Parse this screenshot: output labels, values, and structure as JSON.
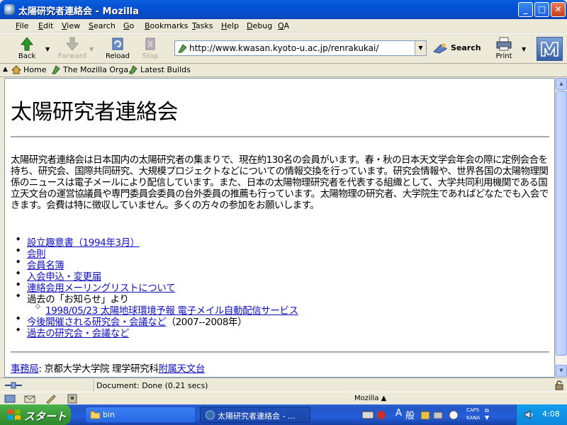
{
  "window": {
    "title": "太陽研究者連絡会 - Mozilla",
    "minimize": "_",
    "maximize": "□",
    "close": "✕"
  },
  "menu": [
    "File",
    "Edit",
    "View",
    "Search",
    "Go",
    "Bookmarks",
    "Tasks",
    "Help",
    "Debug",
    "QA"
  ],
  "toolbar": {
    "back": "Back",
    "forward": "Forward",
    "reload": "Reload",
    "stop": "Stop",
    "url": "http://www.kwasan.kyoto-u.ac.jp/renrakukai/",
    "search": "Search",
    "print": "Print"
  },
  "personal_toolbar": {
    "home": "Home",
    "mozilla_org": "The Mozilla Orga...",
    "latest_builds": "Latest Builds"
  },
  "page": {
    "title": "太陽研究者連絡会",
    "intro": "太陽研究者連絡会は日本国内の太陽研究者の集まりで、現在約130名の会員がいます。春・秋の日本天文学会年会の際に定例会合を持ち、研究会、国際共同研究、大規模プロジェクトなどについての情報交換を行っています。研究会情報や、世界各国の太陽物理関係のニュースは電子メールにより配信しています。また、日本の太陽物理研究者を代表する組織として、大学共同利用機関である国立天文台の運営協議員や専門委員会委員の台外委員の推薦も行っています。太陽物理の研究者、大学院生であればどなたでも入会できます。会費は特に徴収していません。多くの方々の参加をお願いします。",
    "links": [
      "設立趣意書（1994年3月）",
      "会則",
      "会員名簿",
      "入会申込・変更届",
      "連絡会用メーリングリストについて"
    ],
    "news_label": "過去の「お知らせ」より",
    "news_item": "1998/05/23 太陽地球環境予報 電子メイル自動配信サービス",
    "upcoming_link": "今後開催される研究会・会議など",
    "upcoming_suffix": "（2007--2008年）",
    "past_link": "過去の研究会・会議など",
    "footer_link": "事務局",
    "footer_text": ": 京都大学大学院 理学研究科",
    "footer_link2": "附属天文台"
  },
  "status": {
    "text": "Document: Done (0.21 secs)",
    "component": "Mozilla ▲"
  },
  "taskbar": {
    "start": "スタート",
    "items": [
      "bin",
      "太陽研究者連絡会 - ..."
    ],
    "ime_a": "A",
    "ime_mode": "般",
    "caps": "CAPS",
    "kana": "KANA",
    "clock": "4:08"
  },
  "colors": {
    "link": "#1010c0",
    "titlebar": "#0a5fdc",
    "taskbar": "#245edb",
    "start": "#3c9a3a"
  }
}
